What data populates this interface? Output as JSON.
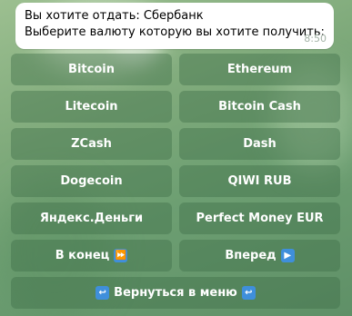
{
  "message": {
    "line1": "Вы хотите отдать: Сбербанк",
    "line2": "Выберите валюту которую вы хотите получить:",
    "time": "8:50"
  },
  "keyboard": {
    "rows": [
      [
        "Bitcoin",
        "Ethereum"
      ],
      [
        "Litecoin",
        "Bitcoin Cash"
      ],
      [
        "ZCash",
        "Dash"
      ],
      [
        "Dogecoin",
        "QIWI RUB"
      ],
      [
        "Яндекс.Деньги",
        "Perfect Money EUR"
      ]
    ],
    "nav": {
      "end_label": "В конец",
      "end_emoji": "⏩",
      "forward_label": "Вперед",
      "forward_emoji": "▶",
      "back_label": "Вернуться в меню",
      "back_emoji": "↩"
    }
  },
  "colors": {
    "button_bg": "#3e6e48",
    "emoji_bg": "#3f8fdb",
    "bubble_bg": "#ffffff"
  }
}
